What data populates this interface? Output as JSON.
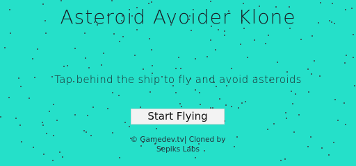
{
  "game": {
    "title": "Asteroid Avoider Klone",
    "instructions": "Tap behind the ship to fly and avoid asteroids",
    "start_button_label": "Start Flying",
    "credit_line1": "© Gamedev.tv| Cloned by",
    "credit_line2": "Sepiks Labs"
  },
  "colors": {
    "background": "#25e0c9",
    "star": "#3a3f45",
    "text": "#1a1f26",
    "button_bg": "#f3f3f3"
  }
}
